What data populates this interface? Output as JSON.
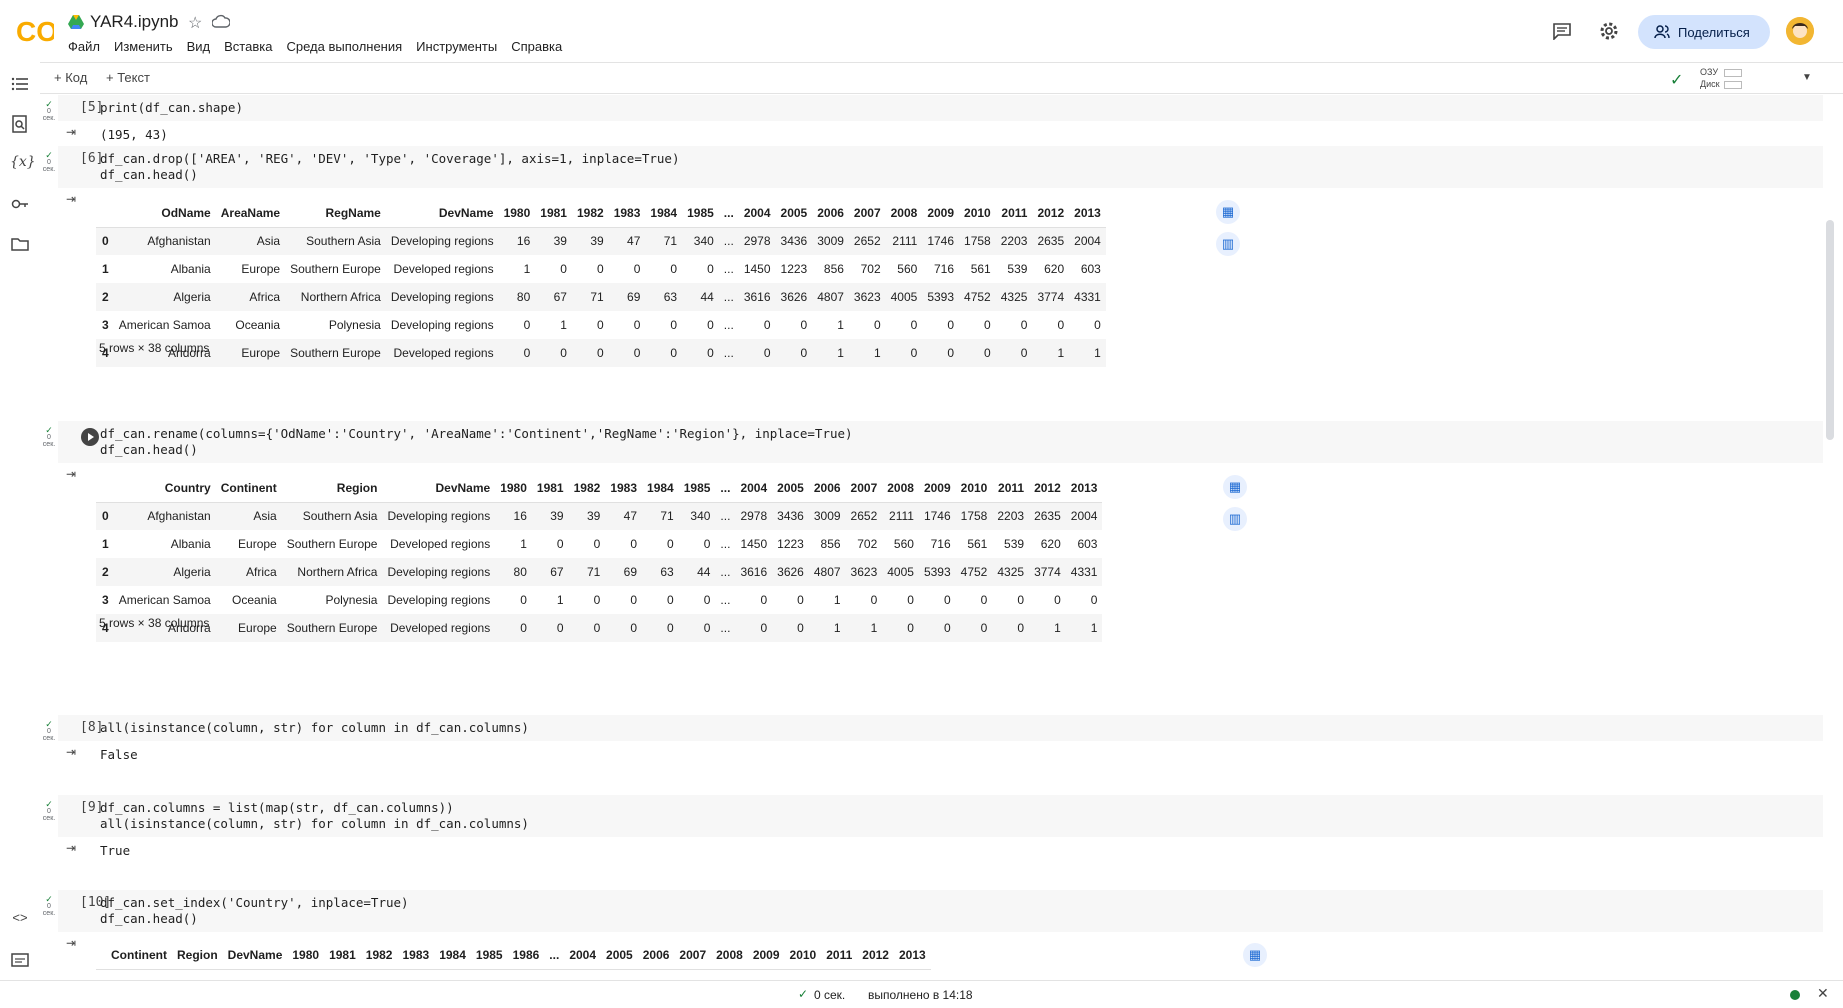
{
  "app": {
    "title": "YAR4.ipynb",
    "logo_text": "CO"
  },
  "menu": [
    "Файл",
    "Изменить",
    "Вид",
    "Вставка",
    "Среда выполнения",
    "Инструменты",
    "Справка"
  ],
  "header": {
    "share_label": "Поделиться"
  },
  "toolbar": {
    "add_code": "+ Код",
    "add_text": "+ Текст",
    "ram_label": "ОЗУ",
    "disk_label": "Диск"
  },
  "cell_meta": {
    "time": "0",
    "unit": "сек."
  },
  "cells": [
    {
      "count": "[5]",
      "code": [
        "print(df_can.shape)"
      ],
      "output": "(195, 43)"
    },
    {
      "count": "[6]",
      "code": [
        "df_can.drop(['AREA', 'REG', 'DEV', 'Type', 'Coverage'], axis=1, inplace=True)",
        "df_can.head()"
      ]
    },
    {
      "count": "",
      "code": [
        "df_can.rename(columns={'OdName':'Country', 'AreaName':'Continent','RegName':'Region'}, inplace=True)",
        "df_can.head()"
      ]
    },
    {
      "count": "[8]",
      "code": [
        "all(isinstance(column, str) for column in df_can.columns)"
      ],
      "output": "False"
    },
    {
      "count": "[9]",
      "code": [
        "df_can.columns = list(map(str, df_can.columns))",
        "all(isinstance(column, str) for column in df_can.columns)"
      ],
      "output": "True"
    },
    {
      "count": "[10]",
      "code": [
        "df_can.set_index('Country', inplace=True)",
        "df_can.head()"
      ]
    }
  ],
  "tables": {
    "t6": {
      "headers": [
        "",
        "OdName",
        "AreaName",
        "RegName",
        "DevName",
        "1980",
        "1981",
        "1982",
        "1983",
        "1984",
        "1985",
        "...",
        "2004",
        "2005",
        "2006",
        "2007",
        "2008",
        "2009",
        "2010",
        "2011",
        "2012",
        "2013"
      ],
      "rows": [
        [
          "0",
          "Afghanistan",
          "Asia",
          "Southern Asia",
          "Developing regions",
          "16",
          "39",
          "39",
          "47",
          "71",
          "340",
          "...",
          "2978",
          "3436",
          "3009",
          "2652",
          "2111",
          "1746",
          "1758",
          "2203",
          "2635",
          "2004"
        ],
        [
          "1",
          "Albania",
          "Europe",
          "Southern Europe",
          "Developed regions",
          "1",
          "0",
          "0",
          "0",
          "0",
          "0",
          "...",
          "1450",
          "1223",
          "856",
          "702",
          "560",
          "716",
          "561",
          "539",
          "620",
          "603"
        ],
        [
          "2",
          "Algeria",
          "Africa",
          "Northern Africa",
          "Developing regions",
          "80",
          "67",
          "71",
          "69",
          "63",
          "44",
          "...",
          "3616",
          "3626",
          "4807",
          "3623",
          "4005",
          "5393",
          "4752",
          "4325",
          "3774",
          "4331"
        ],
        [
          "3",
          "American Samoa",
          "Oceania",
          "Polynesia",
          "Developing regions",
          "0",
          "1",
          "0",
          "0",
          "0",
          "0",
          "...",
          "0",
          "0",
          "1",
          "0",
          "0",
          "0",
          "0",
          "0",
          "0",
          "0"
        ],
        [
          "4",
          "Andorra",
          "Europe",
          "Southern Europe",
          "Developed regions",
          "0",
          "0",
          "0",
          "0",
          "0",
          "0",
          "...",
          "0",
          "0",
          "1",
          "1",
          "0",
          "0",
          "0",
          "0",
          "1",
          "1"
        ]
      ],
      "caption": "5 rows × 38 columns"
    },
    "t7": {
      "headers": [
        "",
        "Country",
        "Continent",
        "Region",
        "DevName",
        "1980",
        "1981",
        "1982",
        "1983",
        "1984",
        "1985",
        "...",
        "2004",
        "2005",
        "2006",
        "2007",
        "2008",
        "2009",
        "2010",
        "2011",
        "2012",
        "2013"
      ],
      "rows": [
        [
          "0",
          "Afghanistan",
          "Asia",
          "Southern Asia",
          "Developing regions",
          "16",
          "39",
          "39",
          "47",
          "71",
          "340",
          "...",
          "2978",
          "3436",
          "3009",
          "2652",
          "2111",
          "1746",
          "1758",
          "2203",
          "2635",
          "2004"
        ],
        [
          "1",
          "Albania",
          "Europe",
          "Southern Europe",
          "Developed regions",
          "1",
          "0",
          "0",
          "0",
          "0",
          "0",
          "...",
          "1450",
          "1223",
          "856",
          "702",
          "560",
          "716",
          "561",
          "539",
          "620",
          "603"
        ],
        [
          "2",
          "Algeria",
          "Africa",
          "Northern Africa",
          "Developing regions",
          "80",
          "67",
          "71",
          "69",
          "63",
          "44",
          "...",
          "3616",
          "3626",
          "4807",
          "3623",
          "4005",
          "5393",
          "4752",
          "4325",
          "3774",
          "4331"
        ],
        [
          "3",
          "American Samoa",
          "Oceania",
          "Polynesia",
          "Developing regions",
          "0",
          "1",
          "0",
          "0",
          "0",
          "0",
          "...",
          "0",
          "0",
          "1",
          "0",
          "0",
          "0",
          "0",
          "0",
          "0",
          "0"
        ],
        [
          "4",
          "Andorra",
          "Europe",
          "Southern Europe",
          "Developed regions",
          "0",
          "0",
          "0",
          "0",
          "0",
          "0",
          "...",
          "0",
          "0",
          "1",
          "1",
          "0",
          "0",
          "0",
          "0",
          "1",
          "1"
        ]
      ],
      "caption": "5 rows × 38 columns"
    },
    "t10": {
      "headers": [
        "",
        "Continent",
        "Region",
        "DevName",
        "1980",
        "1981",
        "1982",
        "1983",
        "1984",
        "1985",
        "1986",
        "...",
        "2004",
        "2005",
        "2006",
        "2007",
        "2008",
        "2009",
        "2010",
        "2011",
        "2012",
        "2013"
      ]
    }
  },
  "status": {
    "time": "0 сек.",
    "done": "выполнено в 14:18"
  },
  "colors": {
    "accent": "#1967d2",
    "success": "#188038",
    "share_bg": "#d3e3fd"
  }
}
